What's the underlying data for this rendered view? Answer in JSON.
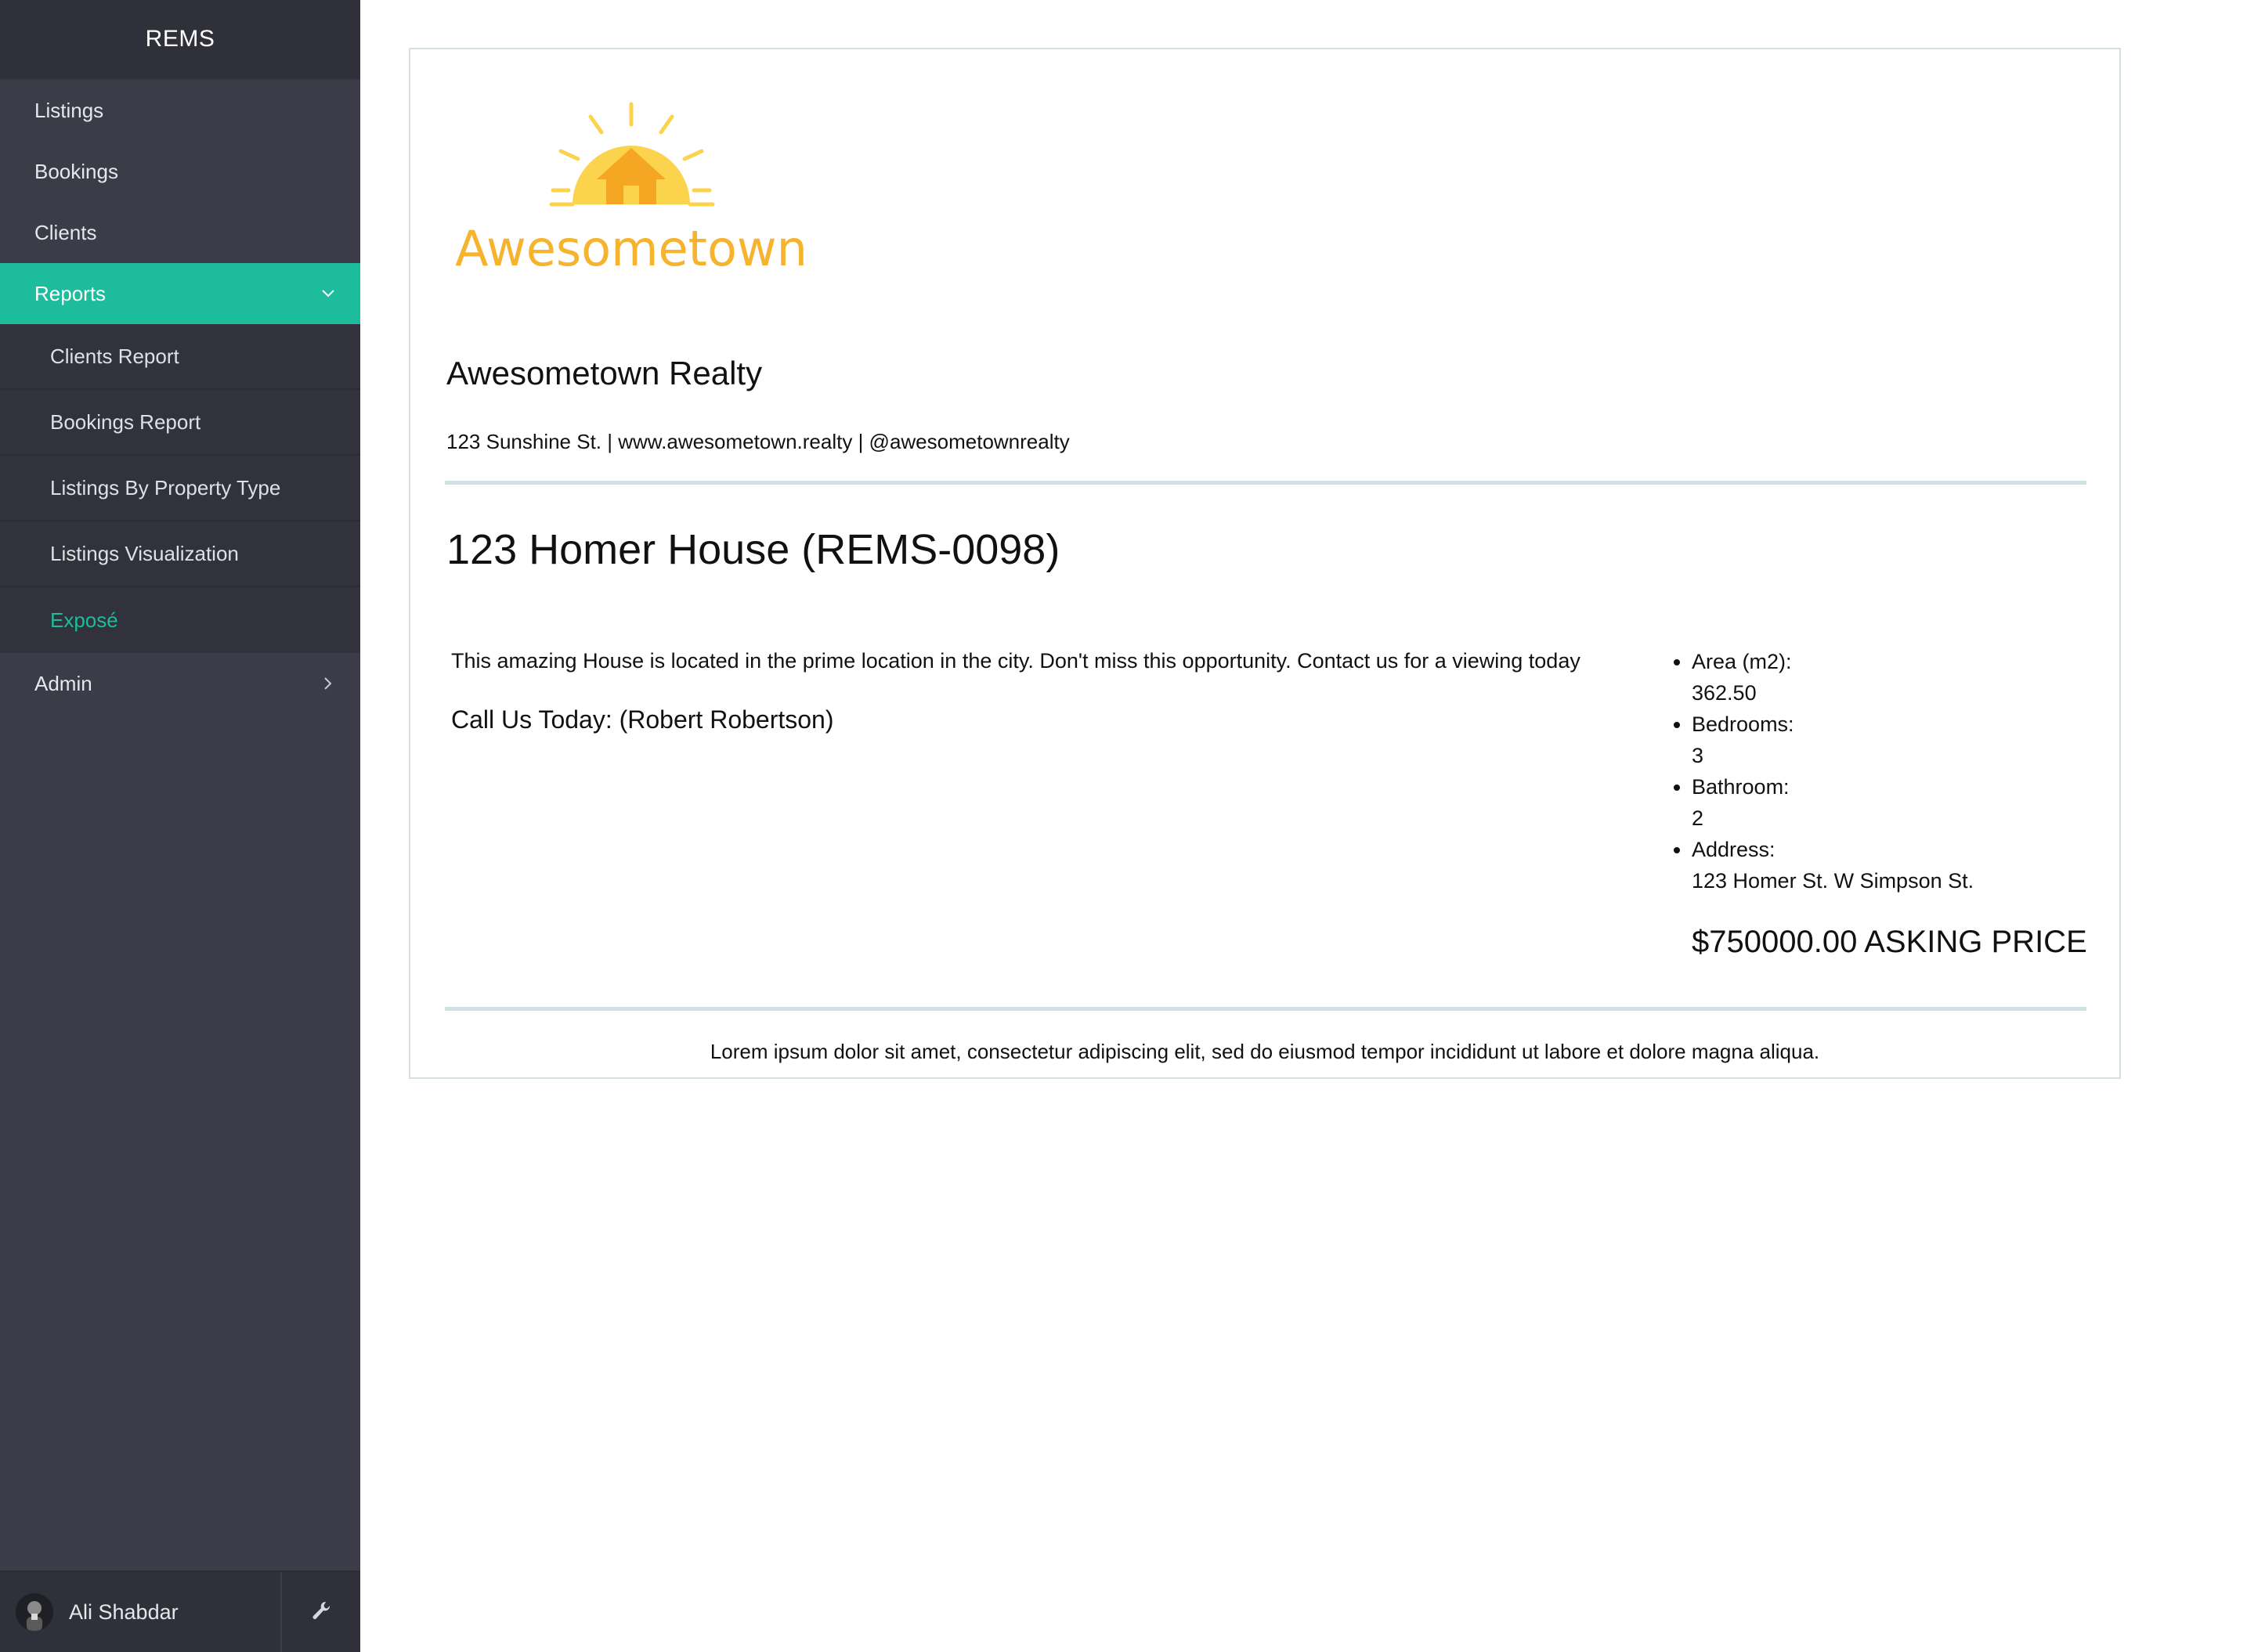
{
  "app": {
    "title": "REMS"
  },
  "sidebar": {
    "items": [
      {
        "label": "Listings"
      },
      {
        "label": "Bookings"
      },
      {
        "label": "Clients"
      },
      {
        "label": "Reports",
        "active": true
      }
    ],
    "reports_submenu": [
      {
        "label": "Clients Report"
      },
      {
        "label": "Bookings Report"
      },
      {
        "label": "Listings By Property Type"
      },
      {
        "label": "Listings Visualization"
      },
      {
        "label": "Exposé",
        "current": true
      }
    ],
    "admin": {
      "label": "Admin"
    },
    "user": {
      "name": "Ali Shabdar"
    },
    "icons": {
      "reports": "chevron-down-icon",
      "admin": "chevron-right-icon",
      "settings": "wrench-icon"
    }
  },
  "expose": {
    "logo_text": "Awesometown",
    "company_name": "Awesometown Realty",
    "company_contact": "123 Sunshine St. | www.awesometown.realty | @awesometownrealty",
    "listing_title": "123 Homer House (REMS-0098)",
    "description": "This amazing House is located in the prime location in the city. Don't miss this opportunity. Contact us for a viewing today",
    "call_us": "Call Us Today: (Robert Robertson)",
    "details": [
      {
        "label": "Area (m2):",
        "value": "362.50"
      },
      {
        "label": "Bedrooms:",
        "value": "3"
      },
      {
        "label": "Bathroom:",
        "value": "2"
      },
      {
        "label": "Address:",
        "value": "123 Homer St. W Simpson St."
      }
    ],
    "price": "$750000.00 ASKING PRICE",
    "footer": "Lorem ipsum dolor sit amet, consectetur adipiscing elit, sed do eiusmod tempor incididunt ut labore et dolore magna aliqua."
  },
  "colors": {
    "sidebar_bg": "#3b3c48",
    "sidebar_dark": "#2f3039",
    "accent": "#1dbc9c",
    "logo_yellow": "#fcd34d",
    "logo_orange": "#f5a623",
    "rule": "#d2dfe1"
  }
}
